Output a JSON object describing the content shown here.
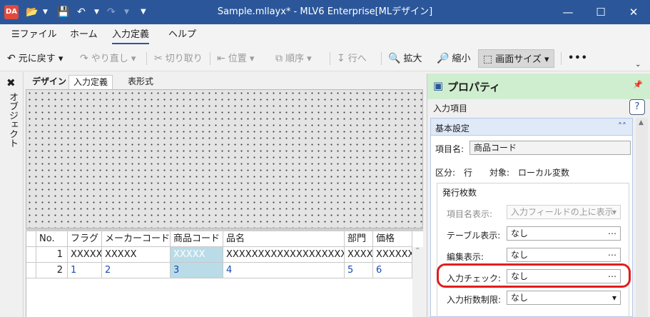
{
  "titlebar": {
    "app_icon": "DA",
    "title": "Sample.mllayx* - MLV6 Enterprise[MLデザイン]",
    "quick_access": [
      "folder-open-icon",
      "save-icon",
      "undo-icon",
      "redo-icon",
      "customize-icon"
    ],
    "accent": "#2b579a"
  },
  "menu": {
    "items": [
      "ファイル",
      "ホーム",
      "入力定義",
      "ヘルプ"
    ],
    "active": "入力定義"
  },
  "toolbar": {
    "undo": "元に戻す",
    "redo": "やり直し",
    "cut": "切り取り",
    "position": "位置",
    "order": "順序",
    "go_to": "行へ",
    "zoom_in": "拡大",
    "zoom_out": "縮小",
    "screen_size": "画面サイズ",
    "more": "•••"
  },
  "left_panel": {
    "label": "オブジェクト"
  },
  "designer_tabs": [
    "デザイン",
    "入力定義",
    "表形式"
  ],
  "grid": {
    "columns": [
      "No.",
      "フラグ",
      "メーカーコード",
      "商品コード",
      "品名",
      "部門",
      "価格"
    ],
    "rows": [
      [
        "1",
        "XXXXX",
        "XXXXX",
        "XXXXX",
        "XXXXXXXXXXXXXXXXXXXXX",
        "XXXX",
        "XXXXXX"
      ],
      [
        "2",
        "1",
        "2",
        "3",
        "4",
        "5",
        "6"
      ]
    ]
  },
  "properties": {
    "title": "プロパティ",
    "subtitle": "入力項目",
    "help": "?",
    "section": "基本設定",
    "item_name_label": "項目名:",
    "item_name_value": "商品コード",
    "category_label": "区分:",
    "category_value": "行",
    "target_label": "対象:",
    "target_value": "ローカル変数",
    "group_title": "発行枚数",
    "fields": [
      {
        "label": "項目名表示:",
        "value": "入力フィールドの上に表示",
        "control": "dropdown",
        "disabled": true
      },
      {
        "label": "テーブル表示:",
        "value": "なし",
        "control": "ellipsis"
      },
      {
        "label": "編集表示:",
        "value": "なし",
        "control": "ellipsis"
      },
      {
        "label": "入力チェック:",
        "value": "なし",
        "control": "ellipsis",
        "highlighted": true
      },
      {
        "label": "入力桁数制限:",
        "value": "なし",
        "control": "dropdown"
      }
    ],
    "highlight_color": "#e01e1e",
    "header_color": "#cfeecf"
  }
}
